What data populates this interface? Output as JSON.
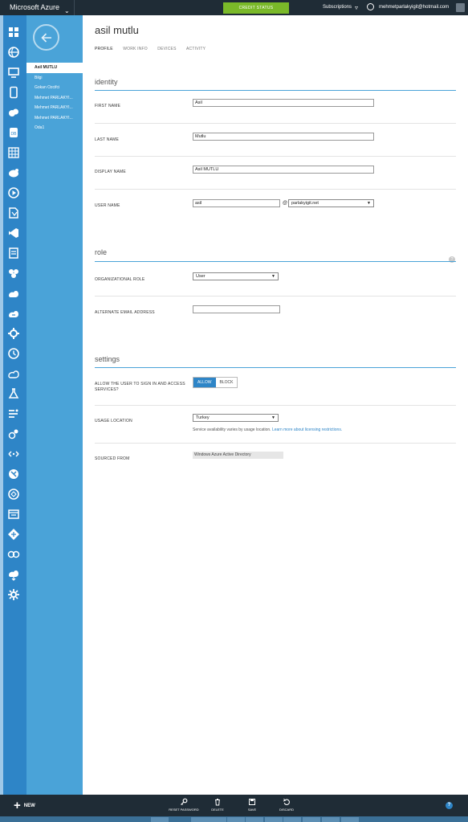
{
  "topbar": {
    "brand": "Microsoft Azure",
    "credit_status": "CREDIT STATUS",
    "subscriptions": "Subscriptions",
    "account_email": "mehmetparlakyigit@hotmail.com"
  },
  "sidebar": {
    "items": [
      {
        "icon": "all-items-icon",
        "active": false
      },
      {
        "icon": "web-sites-icon",
        "active": false
      },
      {
        "icon": "virtual-machines-icon",
        "active": false
      },
      {
        "icon": "mobile-services-icon",
        "active": false
      },
      {
        "icon": "cloud-services-icon",
        "active": false
      },
      {
        "icon": "sql-databases-icon",
        "active": false
      },
      {
        "icon": "storage-icon",
        "active": false
      },
      {
        "icon": "hdinsight-icon",
        "active": false
      },
      {
        "icon": "media-services-icon",
        "active": false
      },
      {
        "icon": "service-bus-icon",
        "active": false
      },
      {
        "icon": "visual-studio-online-icon",
        "active": false
      },
      {
        "icon": "cache-icon",
        "active": false
      },
      {
        "icon": "biztalk-services-icon",
        "active": false
      },
      {
        "icon": "recovery-services-icon",
        "active": false
      },
      {
        "icon": "cdn-icon",
        "active": false
      },
      {
        "icon": "automation-icon",
        "active": false
      },
      {
        "icon": "scheduler-icon",
        "active": false
      },
      {
        "icon": "api-management-icon",
        "active": false
      },
      {
        "icon": "machine-learning-icon",
        "active": false
      },
      {
        "icon": "stream-analytics-icon",
        "active": false
      },
      {
        "icon": "operational-insights-icon",
        "active": false
      },
      {
        "icon": "networks-icon",
        "active": false
      },
      {
        "icon": "traffic-manager-icon",
        "active": false
      },
      {
        "icon": "remoteapp-icon",
        "active": false
      },
      {
        "icon": "management-services-icon",
        "active": false
      },
      {
        "icon": "active-directory-icon",
        "active": true
      },
      {
        "icon": "marketplace-icon",
        "active": false
      },
      {
        "icon": "storsimple-icon",
        "active": false
      },
      {
        "icon": "settings-icon",
        "active": false
      }
    ]
  },
  "subnav": {
    "users": [
      "Asil MUTLU",
      "Bilgi",
      "Gokan Ozcifci",
      "Mehmet PARLAKYI...",
      "Mehmet PARLAKYI...",
      "Mehmet PARLAKYI...",
      "Oda1"
    ]
  },
  "main": {
    "title": "asil mutlu",
    "tabs": [
      "PROFILE",
      "WORK INFO",
      "DEVICES",
      "ACTIVITY"
    ],
    "identity": {
      "heading": "identity",
      "first_name_label": "FIRST NAME",
      "first_name": "Asil",
      "last_name_label": "LAST NAME",
      "last_name": "Mutlu",
      "display_name_label": "DISPLAY NAME",
      "display_name": "Asil MUTLU",
      "user_name_label": "USER NAME",
      "user_name": "asil",
      "at_sign": "@",
      "domain": "parlakyigit.net"
    },
    "role": {
      "heading": "role",
      "org_role_label": "ORGANIZATIONAL ROLE",
      "org_role": "User",
      "alt_email_label": "ALTERNATE EMAIL ADDRESS",
      "alt_email": ""
    },
    "settings": {
      "heading": "settings",
      "sign_in_label": "ALLOW THE USER TO SIGN IN AND ACCESS SERVICES?",
      "allow": "ALLOW",
      "block": "BLOCK",
      "sign_in_value": "ALLOW",
      "usage_location_label": "USAGE LOCATION",
      "usage_location": "Turkey",
      "note_text": "Service availability varies by usage location.",
      "note_link": "Learn more about licensing restrictions.",
      "sourced_from_label": "SOURCED FROM",
      "sourced_from": "Windows Azure Active Directory"
    }
  },
  "commandbar": {
    "new": "NEW",
    "reset_password": "RESET PASSWORD",
    "delete": "DELETE",
    "save": "SAVE",
    "discard": "DISCARD",
    "help": "?"
  },
  "colors": {
    "accent": "#2e85c7",
    "subnav": "#4aa3d8",
    "topbar": "#1f2c36",
    "credit": "#7ab929"
  }
}
